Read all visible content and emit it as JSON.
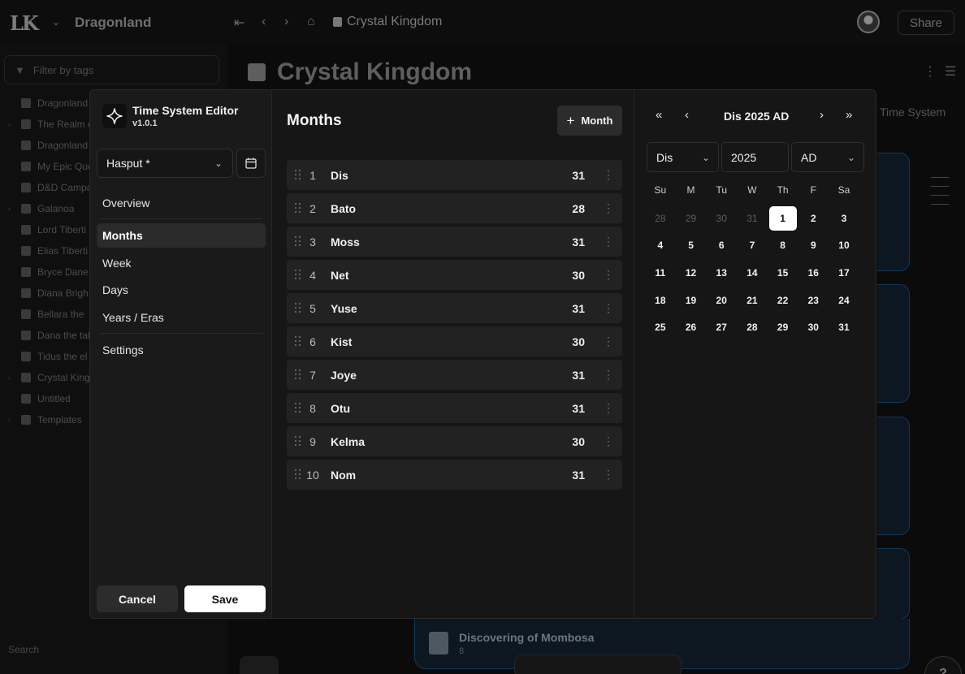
{
  "app": {
    "logo": "LK",
    "workspace": "Dragonland",
    "breadcrumb": "Crystal Kingdom",
    "share_label": "Share",
    "filter_placeholder": "Filter by tags",
    "page_title": "Crystal Kingdom",
    "search_label": "Search",
    "bg_tab": "Time System",
    "bottom_card_title": "Discovering of Mombosa",
    "bottom_card_sub": "8",
    "help_label": "?",
    "tree": [
      {
        "label": "Dragonland",
        "caret": false
      },
      {
        "label": "The Realm of",
        "caret": true
      },
      {
        "label": "Dragonland",
        "caret": false
      },
      {
        "label": "My Epic Que",
        "caret": false
      },
      {
        "label": "D&D Campa",
        "caret": false
      },
      {
        "label": "Galanoa",
        "caret": true
      },
      {
        "label": "Lord Tiberti",
        "caret": false
      },
      {
        "label": "Elias Tiberti",
        "caret": false
      },
      {
        "label": "Bryce Dane",
        "caret": false
      },
      {
        "label": "Diana Brigh",
        "caret": false
      },
      {
        "label": "Bellara the",
        "caret": false
      },
      {
        "label": "Dana the tal",
        "caret": false
      },
      {
        "label": "Tidus the el",
        "caret": false
      },
      {
        "label": "Crystal King",
        "caret": true
      },
      {
        "label": "Untitled",
        "caret": false
      },
      {
        "label": "Templates",
        "caret": true
      }
    ]
  },
  "editor": {
    "plugin_name": "Time System Editor",
    "version": "v1.0.1",
    "time_system": "Hasput *",
    "nav": [
      {
        "label": "Overview",
        "active": false
      },
      {
        "label": "Months",
        "active": true
      },
      {
        "label": "Week",
        "active": false
      },
      {
        "label": "Days",
        "active": false
      },
      {
        "label": "Years / Eras",
        "active": false
      },
      {
        "label": "Settings",
        "active": false
      }
    ],
    "cancel_label": "Cancel",
    "save_label": "Save"
  },
  "months_panel": {
    "title": "Months",
    "add_label": "Month",
    "months": [
      {
        "num": "1",
        "name": "Dis",
        "days": "31"
      },
      {
        "num": "2",
        "name": "Bato",
        "days": "28"
      },
      {
        "num": "3",
        "name": "Moss",
        "days": "31"
      },
      {
        "num": "4",
        "name": "Net",
        "days": "30"
      },
      {
        "num": "5",
        "name": "Yuse",
        "days": "31"
      },
      {
        "num": "6",
        "name": "Kist",
        "days": "30"
      },
      {
        "num": "7",
        "name": "Joye",
        "days": "31"
      },
      {
        "num": "8",
        "name": "Otu",
        "days": "31"
      },
      {
        "num": "9",
        "name": "Kelma",
        "days": "30"
      },
      {
        "num": "10",
        "name": "Nom",
        "days": "31"
      }
    ]
  },
  "calendar": {
    "title": "Dis 2025 AD",
    "month_select": "Dis",
    "year_input": "2025",
    "era_select": "AD",
    "weekdays": [
      "Su",
      "M",
      "Tu",
      "W",
      "Th",
      "F",
      "Sa"
    ],
    "weeks": [
      [
        {
          "d": "28",
          "muted": true
        },
        {
          "d": "29",
          "muted": true
        },
        {
          "d": "30",
          "muted": true
        },
        {
          "d": "31",
          "muted": true
        },
        {
          "d": "1",
          "selected": true
        },
        {
          "d": "2"
        },
        {
          "d": "3"
        }
      ],
      [
        {
          "d": "4"
        },
        {
          "d": "5"
        },
        {
          "d": "6"
        },
        {
          "d": "7"
        },
        {
          "d": "8"
        },
        {
          "d": "9"
        },
        {
          "d": "10"
        }
      ],
      [
        {
          "d": "11"
        },
        {
          "d": "12"
        },
        {
          "d": "13"
        },
        {
          "d": "14"
        },
        {
          "d": "15"
        },
        {
          "d": "16"
        },
        {
          "d": "17"
        }
      ],
      [
        {
          "d": "18"
        },
        {
          "d": "19"
        },
        {
          "d": "20"
        },
        {
          "d": "21"
        },
        {
          "d": "22"
        },
        {
          "d": "23"
        },
        {
          "d": "24"
        }
      ],
      [
        {
          "d": "25"
        },
        {
          "d": "26"
        },
        {
          "d": "27"
        },
        {
          "d": "28"
        },
        {
          "d": "29"
        },
        {
          "d": "30"
        },
        {
          "d": "31"
        }
      ]
    ]
  }
}
